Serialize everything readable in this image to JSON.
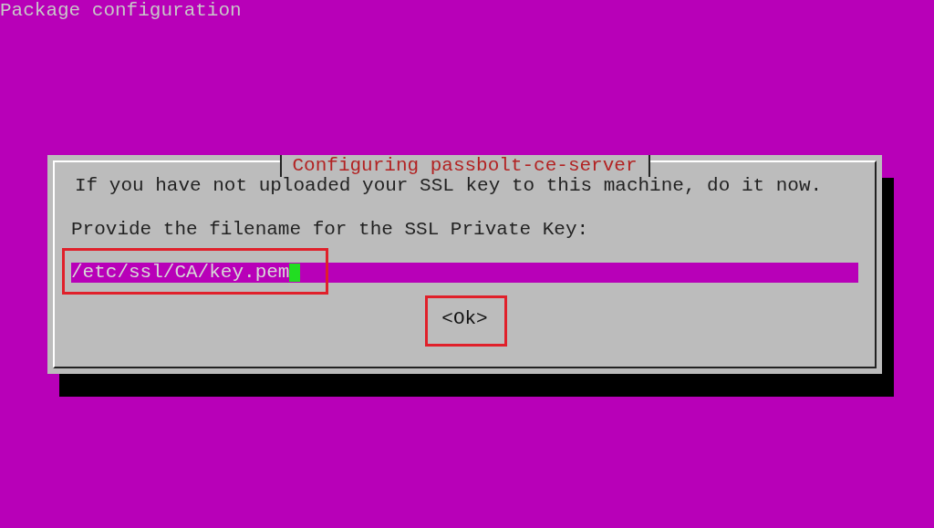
{
  "screen_title": "Package configuration",
  "dialog": {
    "title": "Configuring passbolt-ce-server",
    "message": "If you have not uploaded your SSL key to this machine, do it now.",
    "prompt": "Provide the filename for the SSL Private Key:",
    "input": {
      "value": "/etc/ssl/CA/key.pem",
      "highlighted": true
    },
    "button": {
      "label": "<Ok>",
      "highlighted": true
    }
  }
}
